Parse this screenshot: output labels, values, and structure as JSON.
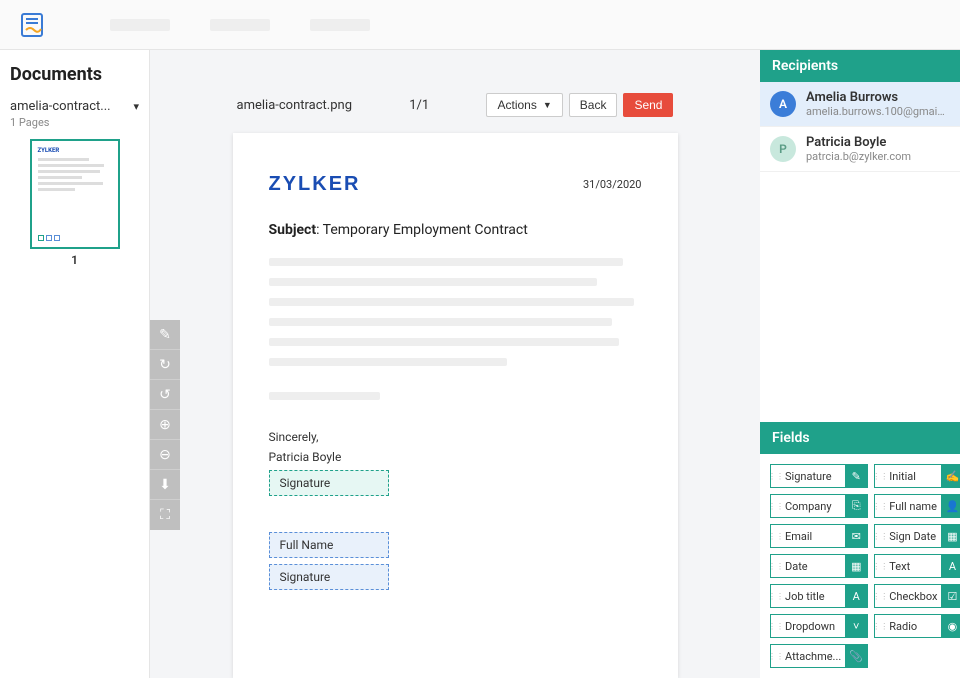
{
  "sidebar": {
    "title": "Documents",
    "docName": "amelia-contract...",
    "pages": "1 Pages",
    "thumbLabel": "1"
  },
  "docHeader": {
    "filename": "amelia-contract.png",
    "pageIndicator": "1/1",
    "actions": "Actions",
    "back": "Back",
    "send": "Send"
  },
  "page": {
    "brand": "ZYLKER",
    "date": "31/03/2020",
    "subjectLabel": "Subject",
    "subjectText": ": Temporary Employment Contract",
    "sincerely": "Sincerely,",
    "signerName": "Patricia Boyle",
    "sigPlaceholder": "Signature",
    "fullNamePlaceholder": "Full Name",
    "sig2Placeholder": "Signature"
  },
  "recipients": {
    "title": "Recipients",
    "items": [
      {
        "initial": "A",
        "name": "Amelia Burrows",
        "email": "amelia.burrows.100@gmail...."
      },
      {
        "initial": "P",
        "name": "Patricia Boyle",
        "email": "patrcia.b@zylker.com"
      }
    ]
  },
  "fieldsPanel": {
    "title": "Fields",
    "items": [
      {
        "label": "Signature",
        "icon": "✎"
      },
      {
        "label": "Initial",
        "icon": "✍"
      },
      {
        "label": "Company",
        "icon": "⎘"
      },
      {
        "label": "Full name",
        "icon": "👤"
      },
      {
        "label": "Email",
        "icon": "✉"
      },
      {
        "label": "Sign Date",
        "icon": "▦"
      },
      {
        "label": "Date",
        "icon": "▦"
      },
      {
        "label": "Text",
        "icon": "A"
      },
      {
        "label": "Job title",
        "icon": "A"
      },
      {
        "label": "Checkbox",
        "icon": "☑"
      },
      {
        "label": "Dropdown",
        "icon": "˅"
      },
      {
        "label": "Radio",
        "icon": "◉"
      },
      {
        "label": "Attachme...",
        "icon": "📎"
      }
    ]
  }
}
